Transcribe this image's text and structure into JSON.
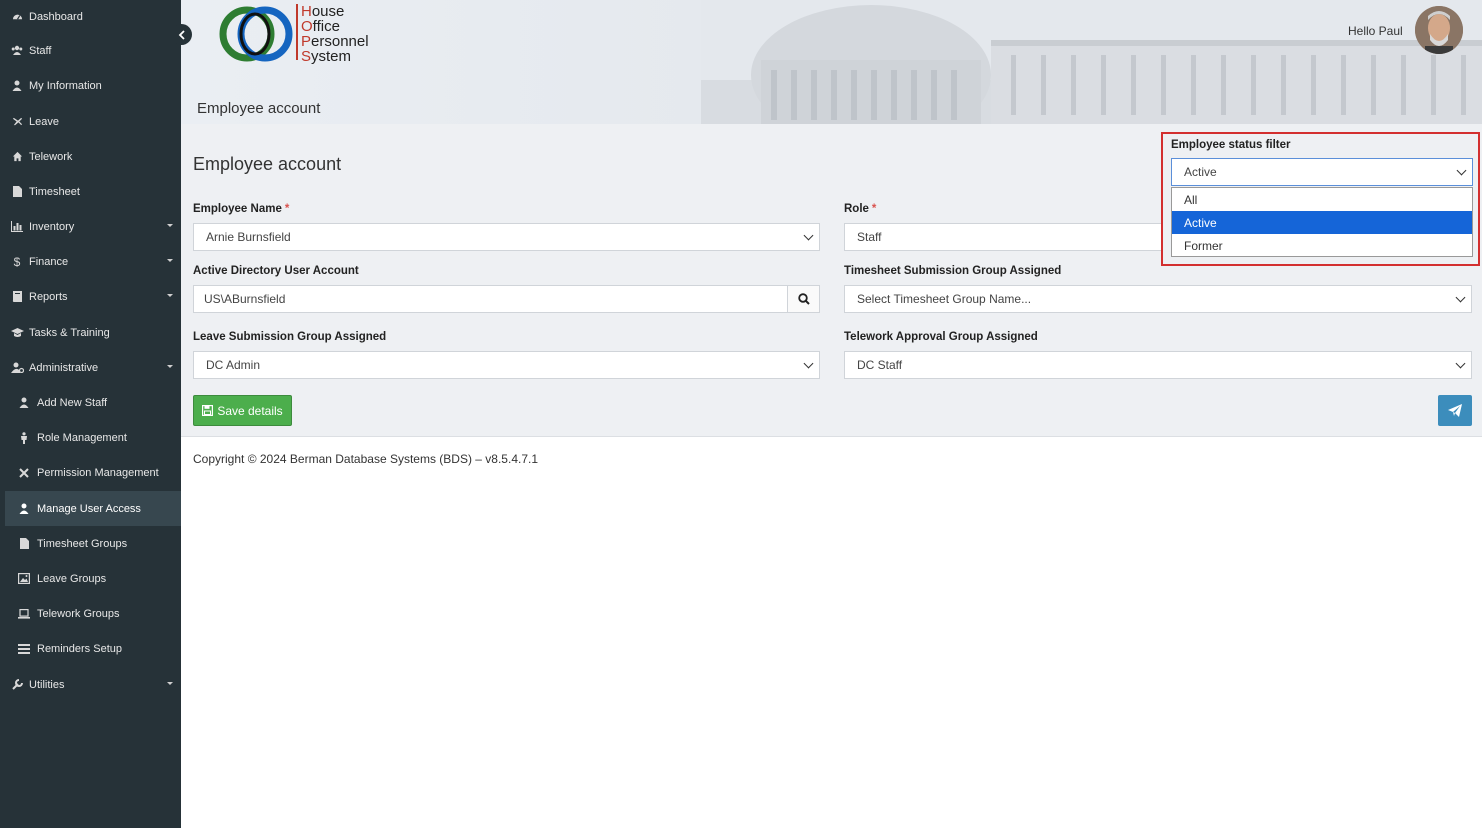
{
  "sidebar": {
    "items": [
      {
        "label": "Dashboard",
        "icon": "dashboard-icon"
      },
      {
        "label": "Staff",
        "icon": "users-icon"
      },
      {
        "label": "My Information",
        "icon": "user-icon"
      },
      {
        "label": "Leave",
        "icon": "plane-icon"
      },
      {
        "label": "Telework",
        "icon": "home-icon"
      },
      {
        "label": "Timesheet",
        "icon": "file-icon"
      },
      {
        "label": "Inventory",
        "icon": "bar-chart-icon"
      },
      {
        "label": "Finance",
        "icon": "dollar-icon"
      },
      {
        "label": "Reports",
        "icon": "book-icon"
      },
      {
        "label": "Tasks & Training",
        "icon": "graduation-cap-icon"
      },
      {
        "label": "Administrative",
        "icon": "user-gear-icon"
      },
      {
        "label": "Add New Staff",
        "icon": "user-icon"
      },
      {
        "label": "Role Management",
        "icon": "person-icon"
      },
      {
        "label": "Permission Management",
        "icon": "wrench-cross-icon"
      },
      {
        "label": "Manage User Access",
        "icon": "user-icon"
      },
      {
        "label": "Timesheet Groups",
        "icon": "file-icon"
      },
      {
        "label": "Leave Groups",
        "icon": "image-icon"
      },
      {
        "label": "Telework Groups",
        "icon": "laptop-icon"
      },
      {
        "label": "Reminders Setup",
        "icon": "list-icon"
      },
      {
        "label": "Utilities",
        "icon": "wrench-icon"
      }
    ]
  },
  "header": {
    "logo_lines": [
      "House",
      "Office",
      "Personnel",
      "System"
    ],
    "page_title": "Employee account",
    "greeting": "Hello Paul"
  },
  "form": {
    "title": "Employee account",
    "employee_name_label": "Employee Name",
    "employee_name_value": "Arnie Burnsfield",
    "role_label": "Role",
    "role_value": "Staff",
    "ad_label": "Active Directory User Account",
    "ad_value": "US\\ABurnsfield",
    "timesheet_group_label": "Timesheet Submission Group Assigned",
    "timesheet_group_placeholder": "Select Timesheet Group Name...",
    "leave_group_label": "Leave Submission Group Assigned",
    "leave_group_value": "DC Admin",
    "telework_group_label": "Telework Approval Group Assigned",
    "telework_group_value": "DC Staff",
    "save_label": "Save details",
    "required_mark": "*"
  },
  "status_filter": {
    "label": "Employee status filter",
    "selected": "Active",
    "options": [
      "All",
      "Active",
      "Former"
    ]
  },
  "footer": {
    "copyright": "Copyright © 2024 Berman Database Systems (BDS) – v8.5.4.7.1"
  },
  "colors": {
    "sidebar_bg": "#263238",
    "save_green": "#4cae4c",
    "send_blue": "#3c8dbc",
    "highlight_red": "#d32f2f",
    "option_selected": "#1565d8"
  }
}
